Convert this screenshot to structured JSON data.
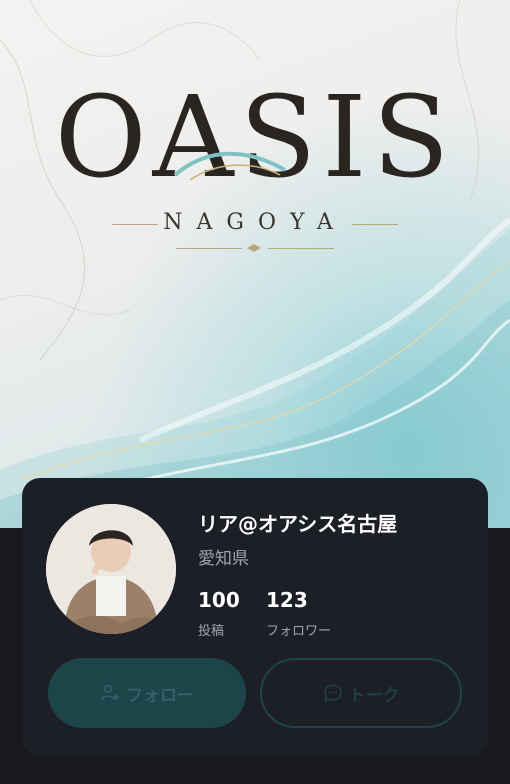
{
  "hero": {
    "logo_word": "OASIS",
    "logo_sub": "NAGOYA"
  },
  "profile": {
    "name": "リア@オアシス名古屋",
    "location": "愛知県",
    "stats": [
      {
        "value": "100",
        "label": "投稿"
      },
      {
        "value": "123",
        "label": "フォロワー"
      }
    ]
  },
  "actions": {
    "follow_label": "フォロー",
    "talk_label": "トーク"
  },
  "colors": {
    "card_bg": "#1d1f27",
    "accent": "#1c4449"
  },
  "icons": {
    "follow": "add-user-icon",
    "talk": "chat-bubble-icon"
  }
}
